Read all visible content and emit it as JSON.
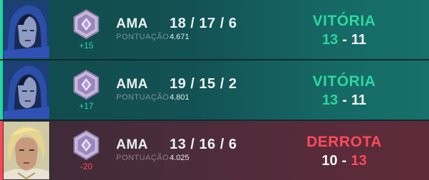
{
  "matches": [
    {
      "outcome": "win",
      "agent_portrait": "blue-hooded-agent-portrait",
      "rank_icon": "rank-emblem-icon",
      "rr_change": "+15",
      "agent": "AMA",
      "kda": "18 / 17 / 6",
      "score_label": "PONTUAÇÃO",
      "score": "4.671",
      "result": "VITÓRIA",
      "rounds_own": "13",
      "rounds_sep": "-",
      "rounds_enemy": "11"
    },
    {
      "outcome": "win",
      "agent_portrait": "blue-hooded-agent-portrait",
      "rank_icon": "rank-emblem-icon",
      "rr_change": "+17",
      "agent": "AMA",
      "kda": "19 / 15 / 2",
      "score_label": "PONTUAÇÃO",
      "score": "4.801",
      "result": "VITÓRIA",
      "rounds_own": "13",
      "rounds_sep": "-",
      "rounds_enemy": "11"
    },
    {
      "outcome": "loss",
      "agent_portrait": "blonde-agent-portrait",
      "rank_icon": "rank-emblem-icon",
      "rr_change": "-20",
      "agent": "AMA",
      "kda": "13 / 16 / 6",
      "score_label": "PONTUAÇÃO",
      "score": "4.025",
      "result": "DERROTA",
      "rounds_own": "10",
      "rounds_sep": "-",
      "rounds_enemy": "13"
    }
  ],
  "colors": {
    "win_accent": "#2ed6a0",
    "loss_accent": "#ff4a5a",
    "win_bg": "#135254",
    "loss_bg": "#4a2c3a"
  }
}
